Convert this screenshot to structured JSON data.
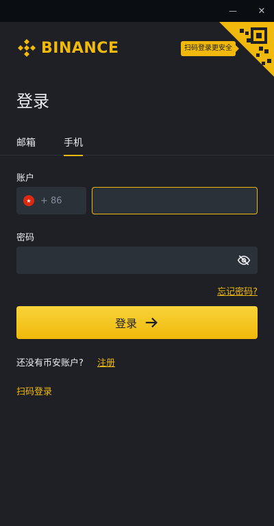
{
  "window": {
    "minimize_glyph": "—",
    "close_glyph": "✕"
  },
  "brand": {
    "name": "BINANCE",
    "color": "#f0b90b"
  },
  "qr_tip": "扫码登录更安全",
  "title": "登录",
  "tabs": [
    {
      "label": "邮箱",
      "active": false
    },
    {
      "label": "手机",
      "active": true
    }
  ],
  "account": {
    "label": "账户",
    "country_code": "+ 86",
    "flag_icon": "china-flag-icon",
    "phone_value": ""
  },
  "password": {
    "label": "密码",
    "value": "",
    "toggle_icon": "eye-off-icon"
  },
  "forgot_label": "忘记密码?",
  "login_button": {
    "label": "登录",
    "icon": "arrow-right-icon"
  },
  "no_account_text": "还没有币安账户?",
  "register_label": "注册",
  "qr_login_label": "扫码登录",
  "colors": {
    "accent": "#f0b90b",
    "background": "#1e2026",
    "input": "#2b3139"
  }
}
